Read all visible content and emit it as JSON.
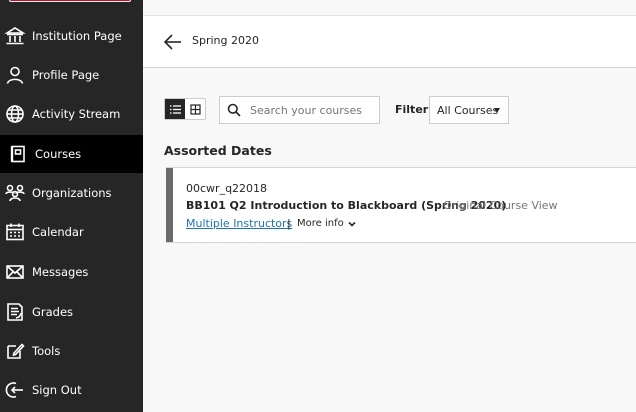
{
  "sidebar": {
    "items": [
      {
        "label": "Institution Page",
        "icon": "institution-icon"
      },
      {
        "label": "Profile Page",
        "icon": "profile-icon"
      },
      {
        "label": "Activity Stream",
        "icon": "globe-icon"
      },
      {
        "label": "Courses",
        "icon": "courses-icon",
        "active": true
      },
      {
        "label": "Organizations",
        "icon": "organizations-icon"
      },
      {
        "label": "Calendar",
        "icon": "calendar-icon"
      },
      {
        "label": "Messages",
        "icon": "envelope-icon"
      },
      {
        "label": "Grades",
        "icon": "grades-icon"
      },
      {
        "label": "Tools",
        "icon": "tools-icon"
      },
      {
        "label": "Sign Out",
        "icon": "sign-out-icon"
      }
    ]
  },
  "header": {
    "title": "Spring 2020"
  },
  "toolbar": {
    "search_placeholder": "Search your courses",
    "filter_label": "Filter",
    "filter_value": "All Courses"
  },
  "section": {
    "title": "Assorted Dates"
  },
  "course": {
    "id": "00cwr_q22018",
    "name": "BB101 Q2 Introduction to Blackboard (Spring 2020)",
    "view": "Original Course View",
    "instructors": "Multiple Instructors",
    "divider": "|",
    "more_info": "More info"
  },
  "colors": {
    "sidebar_bg": "#262626",
    "active_bg": "#000000",
    "link": "#2175b0",
    "brand_red": "#c8102e"
  }
}
